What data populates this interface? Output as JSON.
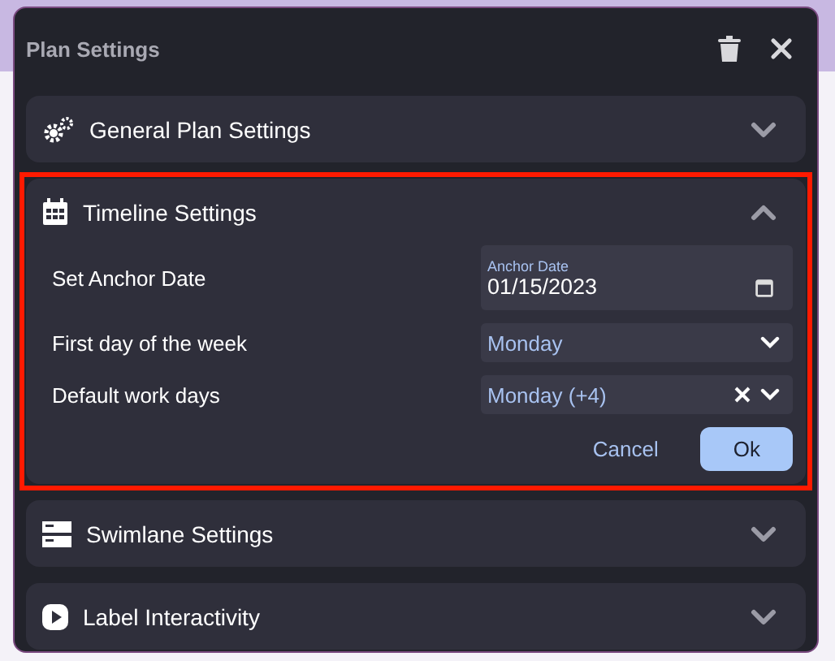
{
  "dialog": {
    "title": "Plan Settings"
  },
  "sections": [
    {
      "title": "General Plan Settings",
      "expanded": false,
      "highlighted": false
    },
    {
      "title": "Timeline Settings",
      "expanded": true,
      "highlighted": true,
      "fields": [
        {
          "kind": "date",
          "label": "Set Anchor Date",
          "field_label": "Anchor Date",
          "value": "01/15/2023"
        },
        {
          "kind": "select",
          "label": "First day of the week",
          "value": "Monday",
          "clearable": false
        },
        {
          "kind": "select",
          "label": "Default work days",
          "value": "Monday (+4)",
          "clearable": true
        }
      ],
      "buttons": [
        {
          "label": "Cancel",
          "kind": "text"
        },
        {
          "label": "Ok",
          "kind": "primary"
        }
      ]
    },
    {
      "title": "Swimlane Settings",
      "expanded": false,
      "highlighted": false
    },
    {
      "title": "Label Interactivity",
      "expanded": false,
      "highlighted": false
    }
  ]
}
